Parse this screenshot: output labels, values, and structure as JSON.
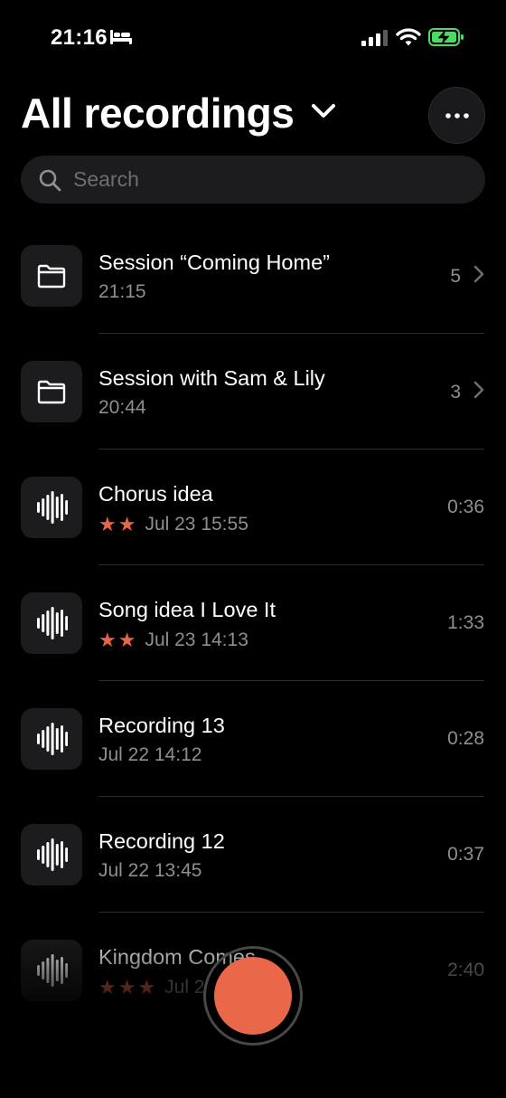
{
  "status_bar": {
    "time": "21:16"
  },
  "header": {
    "title": "All recordings"
  },
  "search": {
    "placeholder": "Search",
    "value": ""
  },
  "items": [
    {
      "type": "folder",
      "title": "Session “Coming Home”",
      "subtitle": "21:15",
      "stars": "",
      "meta": "5"
    },
    {
      "type": "folder",
      "title": "Session with Sam & Lily",
      "subtitle": "20:44",
      "stars": "",
      "meta": "3"
    },
    {
      "type": "recording",
      "title": "Chorus idea",
      "subtitle": "Jul 23 15:55",
      "stars": "★★",
      "meta": "0:36"
    },
    {
      "type": "recording",
      "title": "Song idea I Love It",
      "subtitle": "Jul 23 14:13",
      "stars": "★★",
      "meta": "1:33"
    },
    {
      "type": "recording",
      "title": "Recording 13",
      "subtitle": "Jul 22 14:12",
      "stars": "",
      "meta": "0:28"
    },
    {
      "type": "recording",
      "title": "Recording 12",
      "subtitle": "Jul 22 13:45",
      "stars": "",
      "meta": "0:37"
    },
    {
      "type": "recording",
      "title": "Kingdom Comes",
      "subtitle": "Jul 2",
      "stars": "★★★",
      "meta": "2:40"
    }
  ],
  "colors": {
    "accent": "#eb6749",
    "background": "#000000",
    "cell": "#1c1c1e",
    "secondary_text": "#8e8e93"
  }
}
